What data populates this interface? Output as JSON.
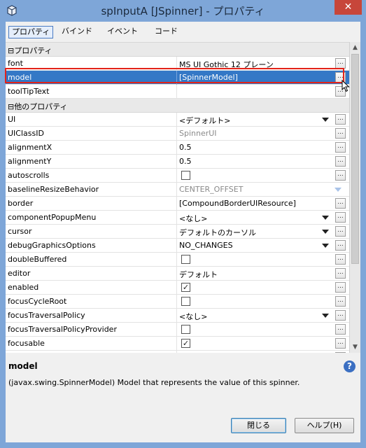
{
  "window": {
    "title": "spInputA [JSpinner] - プロパティ",
    "close_label": "✕",
    "accent": "#7ea6d8",
    "close_color": "#c7463a"
  },
  "tabs": [
    {
      "label": "プロパティ",
      "active": true
    },
    {
      "label": "バインド",
      "active": false
    },
    {
      "label": "イベント",
      "active": false
    },
    {
      "label": "コード",
      "active": false
    }
  ],
  "categories": {
    "properties": "⊟プロパティ",
    "other": "⊟他のプロパティ"
  },
  "rows": [
    {
      "name": "font",
      "value": "MS UI Gothic 12 プレーン",
      "ellipsis": true
    },
    {
      "name": "model",
      "value": "[SpinnerModel]",
      "ellipsis": true,
      "selected": true
    },
    {
      "name": "toolTipText",
      "value": "",
      "ellipsis": true
    },
    {
      "name": "UI",
      "value": "<デフォルト>",
      "value_gray": true,
      "dropdown": true,
      "ellipsis": true
    },
    {
      "name": "UIClassID",
      "value": "SpinnerUI",
      "value_gray": true,
      "ellipsis": true
    },
    {
      "name": "alignmentX",
      "value": "0.5",
      "ellipsis": true
    },
    {
      "name": "alignmentY",
      "value": "0.5",
      "ellipsis": true
    },
    {
      "name": "autoscrolls",
      "checkbox": false,
      "ellipsis": true
    },
    {
      "name": "baselineResizeBehavior",
      "value": "CENTER_OFFSET",
      "value_gray": true,
      "dropdown_light": true
    },
    {
      "name": "border",
      "value": "[CompoundBorderUIResource]",
      "ellipsis": true
    },
    {
      "name": "componentPopupMenu",
      "value": "<なし>",
      "dropdown": true,
      "ellipsis": true
    },
    {
      "name": "cursor",
      "value": "デフォルトのカーソル",
      "dropdown": true,
      "ellipsis": true
    },
    {
      "name": "debugGraphicsOptions",
      "value": "NO_CHANGES",
      "dropdown": true,
      "ellipsis": true
    },
    {
      "name": "doubleBuffered",
      "checkbox": false,
      "ellipsis": true
    },
    {
      "name": "editor",
      "value": "デフォルト",
      "ellipsis": true
    },
    {
      "name": "enabled",
      "checkbox": true,
      "ellipsis": true
    },
    {
      "name": "focusCycleRoot",
      "checkbox": false,
      "ellipsis": true
    },
    {
      "name": "focusTraversalPolicy",
      "value": "<なし>",
      "dropdown": true,
      "ellipsis": true
    },
    {
      "name": "focusTraversalPolicyProvider",
      "checkbox": false,
      "ellipsis": true
    },
    {
      "name": "focusable",
      "checkbox": true,
      "ellipsis": true
    },
    {
      "name": "inheritsPopupMenu",
      "checkbox": false,
      "ellipsis": true
    }
  ],
  "ellipsis_label": "...",
  "check_mark": "✓",
  "description": {
    "title": "model",
    "text": "(javax.swing.SpinnerModel) Model that represents the value of this spinner.",
    "help_label": "?"
  },
  "buttons": {
    "close": "閉じる",
    "help": "ヘルプ(H)"
  },
  "selection_color": "#3478c6",
  "highlight_frame_color": "#e2231a"
}
